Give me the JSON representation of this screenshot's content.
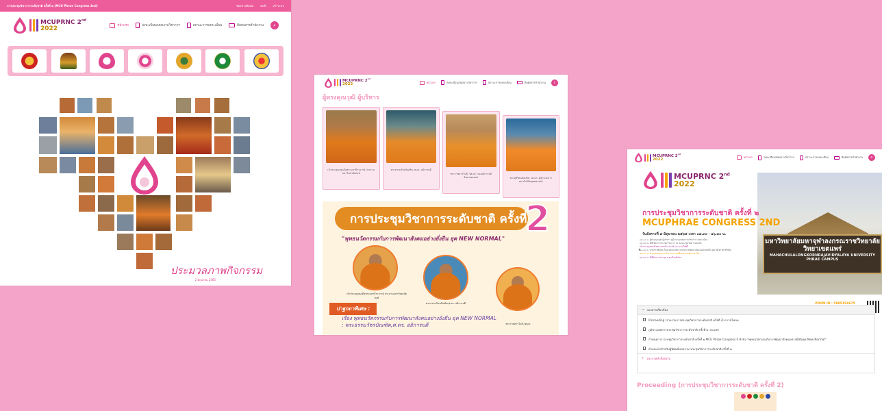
{
  "common": {
    "brand_name": "MCUPRNC 2",
    "brand_sup": "nd",
    "brand_year": "2022",
    "nav": {
      "home": "หน้าแรก",
      "register": "ลงทะเบียนส่งผลงานวิชาการ",
      "status": "สถานะการลงทะเบียน",
      "contact": "ติดต่อสารสำนักงาน"
    }
  },
  "shot1": {
    "topbar_title": "การประชุมวิชาการระดับชาติ ครั้งที่ ๒ (MCU Phrae Congress 2nd)",
    "topbar_links": [
      "ช่องทางติดต่อ",
      "คนปี",
      "เข้าระบบ"
    ],
    "caption": "ประมวลภาพกิจกรรม",
    "date": "2 มิถุนายน 2565"
  },
  "shot2": {
    "section_title": "ผู้ทรงคุณวุฒิ ผู้บริหาร",
    "admins": [
      {
        "caption": "เจ้าประคุณสมเด็จพระมหาธีราจารย์ ประธานมหาวิทยาลัยสงฆ์"
      },
      {
        "caption": "พระธรรมวัชรบัณฑิต, ศ.ดร. อธิการบดี"
      },
      {
        "caption": "พระราชสารโมลี, รศ.ดร. รองอธิการบดีวิทยาเขตแพร่"
      },
      {
        "caption": "พระสุธีรัตนบัณฑิต, รศ.ดร. ผู้อำนวยการสถาบันวิจัยพุทธศาสตร์"
      }
    ],
    "poster": {
      "banner": "การประชุมวิชาการระดับชาติ ครั้งที่",
      "banner_num": "2",
      "theme": "\"พุทธนวัตกรรมกับการพัฒนาสังคมอย่างยั่งยืน ยุค NEW NORMAL\"",
      "people": [
        {
          "caption": "เจ้าประคุณสมเด็จพระมหาธีราจารย์ ประธานมหาวิทยาลัยสงฆ์"
        },
        {
          "caption": "พระธรรมวัชรบัณฑิต,ศ.ดร. อธิการบดี"
        },
        {
          "caption": "พระราชสารโมลี,รศ.ดร."
        }
      ],
      "tag": "ปาฐกถาพิเศษ :",
      "sub_line1": "เรื่อง พุทธนวัตกรรมกับการพัฒนาสังคมอย่างยั่งยืน ยุค NEW NORMAL",
      "sub_line2": ": พระธรรมวัชรบัณฑิต,ศ.ดร. อธิการบดี"
    }
  },
  "shot3": {
    "hero": {
      "headline": "การประชุมวิชาการระดับชาติ ครั้งที่ ๒",
      "congress": "MCUPHRAE CONGRESS 2ND",
      "date": "วันอังคารที่ ๗ มิถุนายน ๒๕๖๕ เวลา ๐๘.๓๐ - ๑๖.๓๐ น.",
      "schedule": [
        "๐๙.๐๐ น. ผู้ทรงคุณวุฒิ ผู้บริหาร ผู้นำเสนอบทความวิชาการ ลงทะเบียน",
        "๐๙.๓๐ น. พิธีเปิดการประชุมวิชาการ ณ หอประชุมวิทยาเขตแพร่",
        "เจ้าประคุณสมเด็จพระมหาธีราจารย์ ประธานในพิธี",
        "๑๐.๐๐ น. ปาฐกถาพิเศษ เรื่อง พุทธนวัตกรรมกับการพัฒนาสังคมอย่างยั่งยืน ยุค NEW NORMAL",
        "๑๓.๐๐ น. นำเสนอบทความวิชาการ แบ่งห้องตามกลุ่มสาขาวิชา",
        "๑๖.๓๐ น. พิธีปิดการประชุม มอบเกียรติบัตร"
      ],
      "place": "ณ มหาวิทยาลัยมหาจุฬาลงกรณราชวิทยาลัย วิทยาเขตแพร่",
      "sign_th": "มหาวิทยาลัยมหาจุฬาลงกรณราชวิทยาลัย วิทยาเขตแพร่",
      "sign_en_1": "MAHACHULALONGKORNRAJAVIDYALAYA UNIVERSITY",
      "sign_en_2": "PHRAE CAMPUS",
      "zoom_1": "ZOOM ID : 5885154675",
      "zoom_2": "https://zoom.us/j/5885154675",
      "prev": "‹",
      "dots": "• • • •"
    },
    "accordion": {
      "title": "เอกสารเกี่ยวข้อง",
      "items": [
        "Proceeding (รายงานการประชุมวิชาการระดับชาติ ครั้งที่ 2) ดาวน์โหลด",
        "ภูมิประเทศการประชุมวิชาการระดับชาติ ครั้งที่ ๒ วข.แพร่",
        "กำหนดการ ประชุมวิชาการระดับชาติ ครั้งที่ ๒ MCU Phrae Congress II หัวข้อ \"พุทธนวัตกรรมกับการพัฒนาสังคมอย่างยั่งยืนยุค New Normal\"",
        "คำแนะนำสำหรับผู้นิพนธ์บทความ ประชุมวิชาการระดับชาติ ครั้งที่ ๒"
      ],
      "footer": "ประกาศทำตั้งต่อไป"
    },
    "proc_title": "Proceeding (การประชุมวิชาการระดับชาติ ครั้งที่ 2)"
  }
}
